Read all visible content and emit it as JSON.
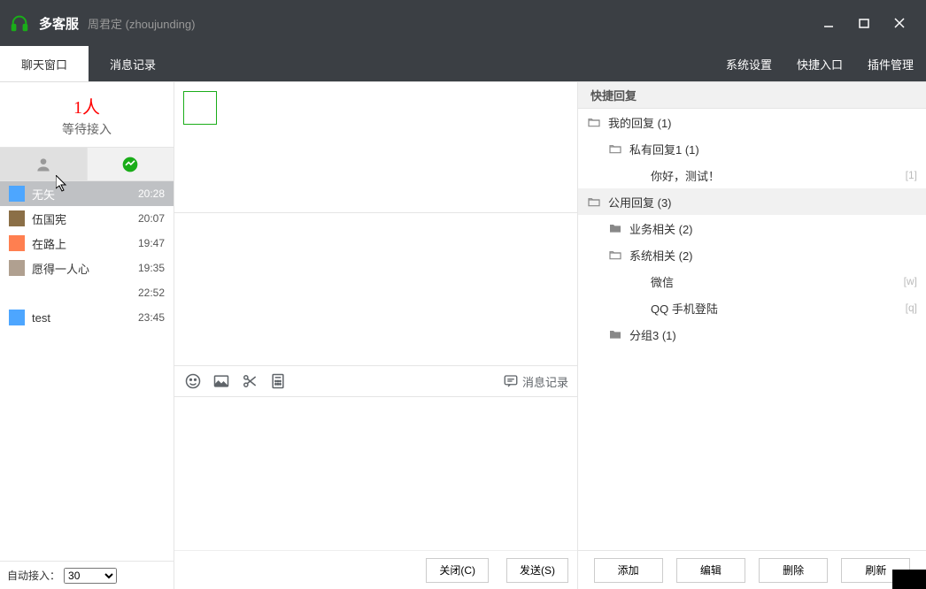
{
  "title": "多客服",
  "subtitle": "周君定 (zhoujunding)",
  "tabs": {
    "chat": "聊天窗口",
    "history": "消息记录"
  },
  "menu": {
    "settings": "系统设置",
    "quick": "快捷入口",
    "plugins": "插件管理"
  },
  "waiting": {
    "count": "1人",
    "label": "等待接入"
  },
  "chatlist": [
    {
      "name": "无矢",
      "time": "20:28",
      "sel": true
    },
    {
      "name": "伍国宪",
      "time": "20:07"
    },
    {
      "name": "在路上",
      "time": "19:47"
    },
    {
      "name": "愿得一人心",
      "time": "19:35"
    },
    {
      "name": "",
      "time": "22:52"
    },
    {
      "name": "test",
      "time": "23:45"
    }
  ],
  "autojoin": {
    "label": "自动接入：",
    "value": "30"
  },
  "toolbar": {
    "history": "消息记录"
  },
  "midactions": {
    "close": "关闭(C)",
    "send": "发送(S)"
  },
  "righthead": "快捷回复",
  "tree": [
    {
      "ind": 0,
      "icon": "folder-open",
      "label": "我的回复 (1)"
    },
    {
      "ind": 1,
      "icon": "folder-open",
      "label": "私有回复1 (1)"
    },
    {
      "ind": 2,
      "icon": "",
      "label": "你好，测试！",
      "shortcut": "[1]"
    },
    {
      "ind": 0,
      "icon": "folder-open",
      "label": "公用回复 (3)",
      "sel": true
    },
    {
      "ind": 1,
      "icon": "folder",
      "label": "业务相关 (2)"
    },
    {
      "ind": 1,
      "icon": "folder-open",
      "label": "系统相关 (2)"
    },
    {
      "ind": 2,
      "icon": "",
      "label": "微信",
      "shortcut": "[w]"
    },
    {
      "ind": 2,
      "icon": "",
      "label": "QQ 手机登陆",
      "shortcut": "[q]"
    },
    {
      "ind": 1,
      "icon": "folder",
      "label": "分组3 (1)"
    }
  ],
  "rightactions": {
    "add": "添加",
    "edit": "编辑",
    "del": "删除",
    "refresh": "刷新"
  }
}
